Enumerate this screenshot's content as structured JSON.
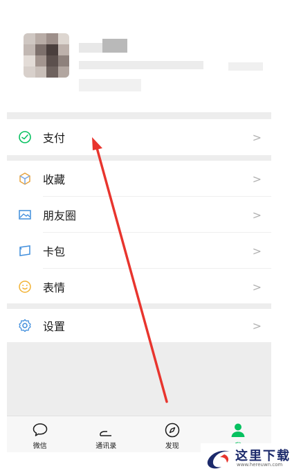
{
  "menu": [
    {
      "id": "pay",
      "label": "支付",
      "icon": "wallet-check-icon",
      "color": "#07c160"
    },
    {
      "id": "favorites",
      "label": "收藏",
      "icon": "cube-icon",
      "color": "#e8a33d"
    },
    {
      "id": "moments",
      "label": "朋友圈",
      "icon": "picture-icon",
      "color": "#3f8ddc"
    },
    {
      "id": "cards",
      "label": "卡包",
      "icon": "card-icon",
      "color": "#3f8ddc"
    },
    {
      "id": "stickers",
      "label": "表情",
      "icon": "smile-icon",
      "color": "#f2b233"
    },
    {
      "id": "settings",
      "label": "设置",
      "icon": "gear-icon",
      "color": "#3f8ddc"
    }
  ],
  "chevron": ">",
  "tabs": [
    {
      "label": "微信",
      "icon": "chat-bubble-icon",
      "active": false
    },
    {
      "label": "通讯录",
      "icon": "contacts-icon",
      "active": false
    },
    {
      "label": "发现",
      "icon": "compass-icon",
      "active": false
    },
    {
      "label": "我",
      "icon": "person-icon",
      "active": true
    }
  ],
  "accent": "#07c160",
  "annotation_color": "#e8352e",
  "watermark": {
    "text": "这里下载",
    "url": "www.hereuwn.com"
  }
}
